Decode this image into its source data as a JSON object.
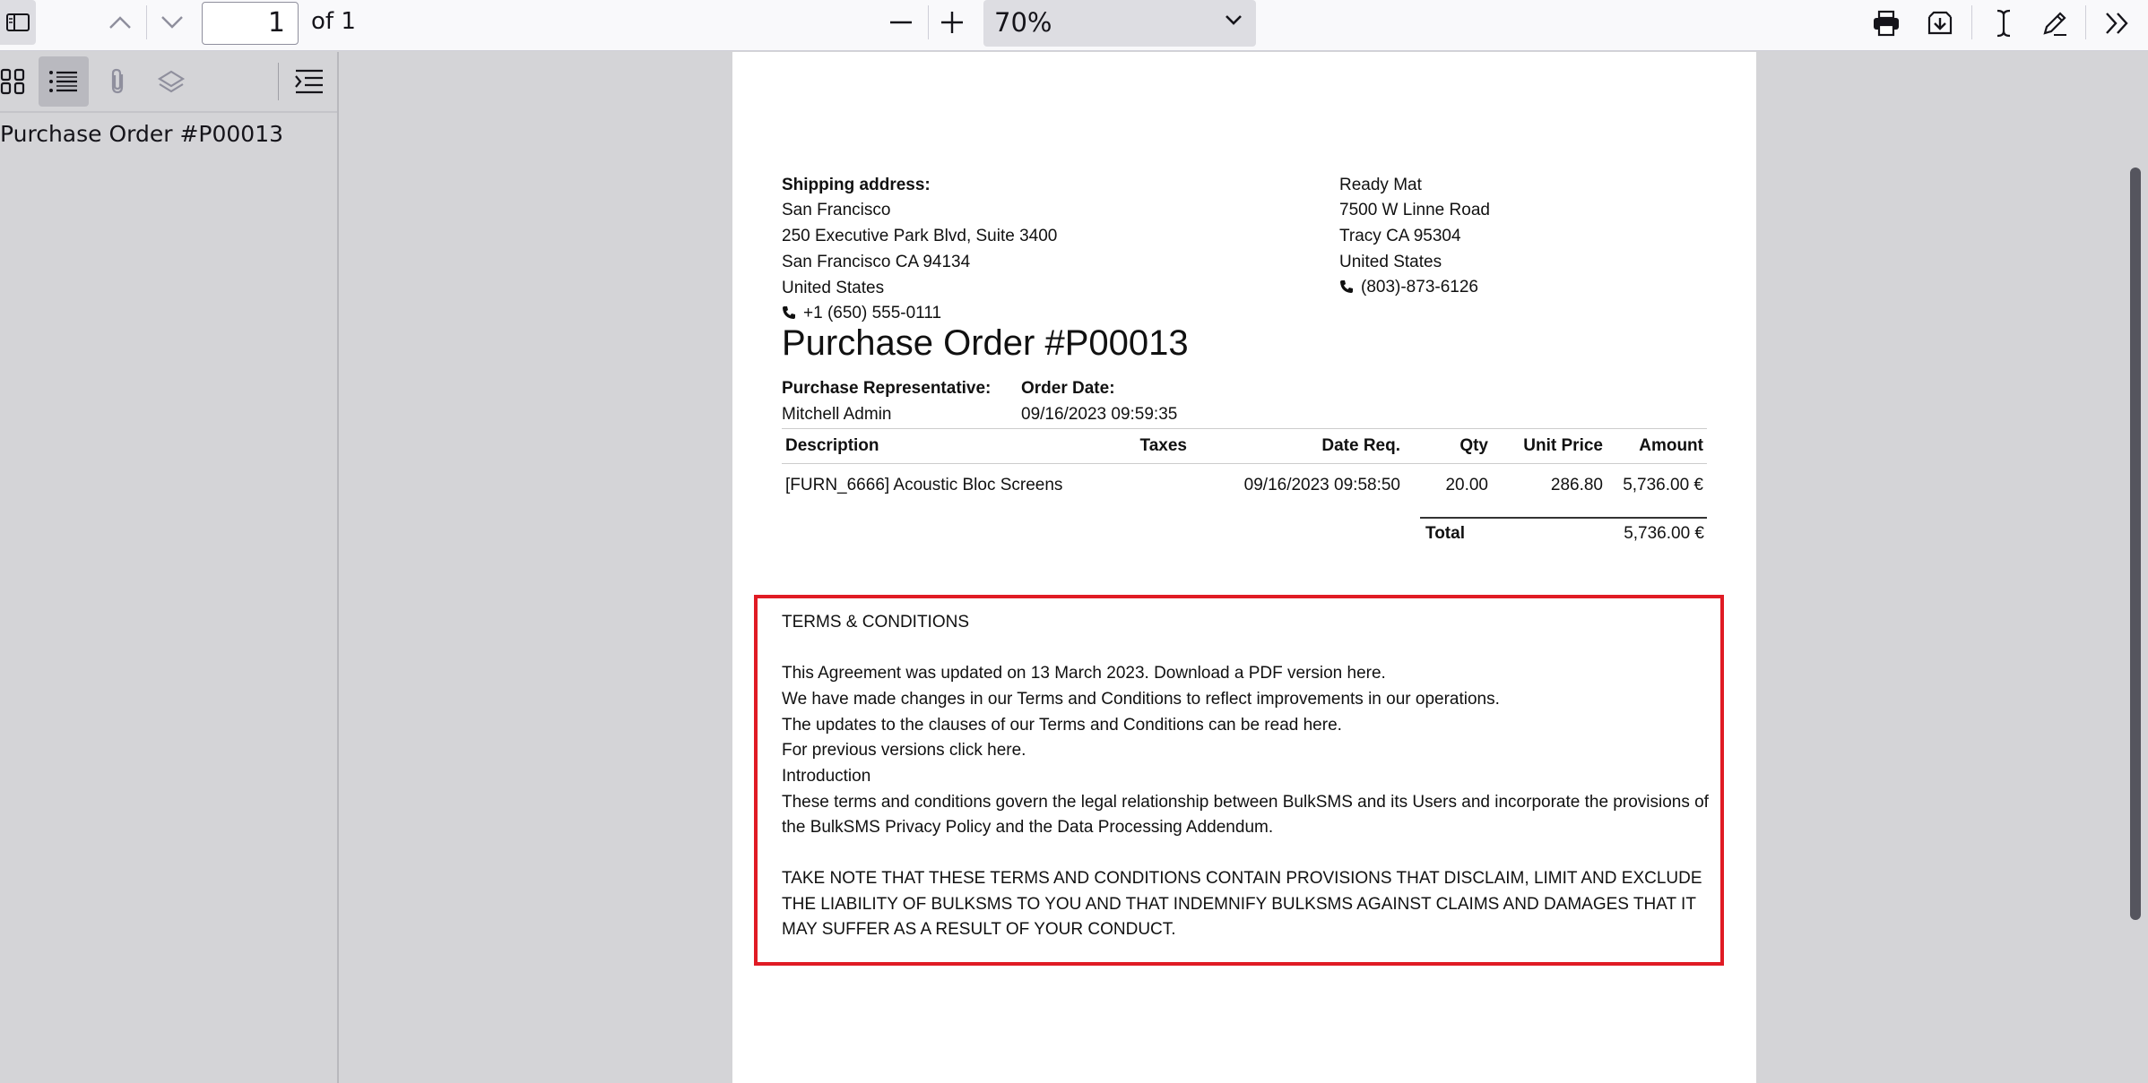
{
  "toolbar": {
    "page_number": "1",
    "page_count_label": "of 1",
    "zoom_value": "70%",
    "icons": [
      "sidebar-toggle-icon",
      "previous-page-icon",
      "next-page-icon",
      "zoom-out-icon",
      "zoom-in-icon",
      "print-icon",
      "save-icon",
      "text-cursor-icon",
      "draw-icon",
      "tools-icon"
    ]
  },
  "sidebar": {
    "buttons": [
      "thumbnails-icon",
      "outline-icon",
      "attachments-icon",
      "layers-icon",
      "current-outline-item-icon"
    ],
    "outline_items": [
      "Purchase Order #P00013"
    ]
  },
  "document": {
    "shipping": {
      "label": "Shipping address:",
      "lines": [
        "San Francisco",
        "250 Executive Park Blvd, Suite 3400",
        "San Francisco CA 94134",
        "United States"
      ],
      "phone": "+1 (650) 555-0111"
    },
    "vendor": {
      "lines": [
        "Ready Mat",
        "7500 W Linne Road",
        "Tracy CA 95304",
        "United States"
      ],
      "phone": "(803)-873-6126"
    },
    "title": "Purchase Order #P00013",
    "rep_label": "Purchase Representative:",
    "rep_value": "Mitchell Admin",
    "date_label": "Order Date:",
    "date_value": "09/16/2023 09:59:35",
    "table": {
      "headers": [
        "Description",
        "Taxes",
        "Date Req.",
        "Qty",
        "Unit Price",
        "Amount"
      ],
      "rows": [
        [
          "[FURN_6666] Acoustic Bloc Screens",
          "",
          "09/16/2023 09:58:50",
          "20.00",
          "286.80",
          "5,736.00 €"
        ]
      ]
    },
    "total_label": "Total",
    "total_value": "5,736.00 €",
    "terms": {
      "heading": "TERMS & CONDITIONS",
      "lines": [
        "This Agreement was updated on 13 March 2023. Download a PDF version here.",
        "We have made changes in our Terms and Conditions to reflect improvements in our operations.",
        "The updates to the clauses of our Terms and Conditions can be read here.",
        "For previous versions click here.",
        "Introduction",
        "These terms and conditions govern the legal relationship between BulkSMS and its Users and incorporate the provisions of",
        "the BulkSMS Privacy Policy and the Data Processing Addendum."
      ],
      "notice_lines": [
        "TAKE NOTE THAT THESE TERMS AND CONDITIONS CONTAIN PROVISIONS THAT DISCLAIM, LIMIT AND EXCLUDE",
        "THE LIABILITY OF BULKSMS TO YOU AND THAT INDEMNIFY BULKSMS AGAINST CLAIMS AND DAMAGES THAT IT",
        "MAY SUFFER AS A RESULT OF YOUR CONDUCT."
      ]
    }
  },
  "colors": {
    "highlight_border": "#e01b24",
    "toolbar_bg": "#f9f9fb",
    "viewer_bg": "#d4d4d7"
  }
}
